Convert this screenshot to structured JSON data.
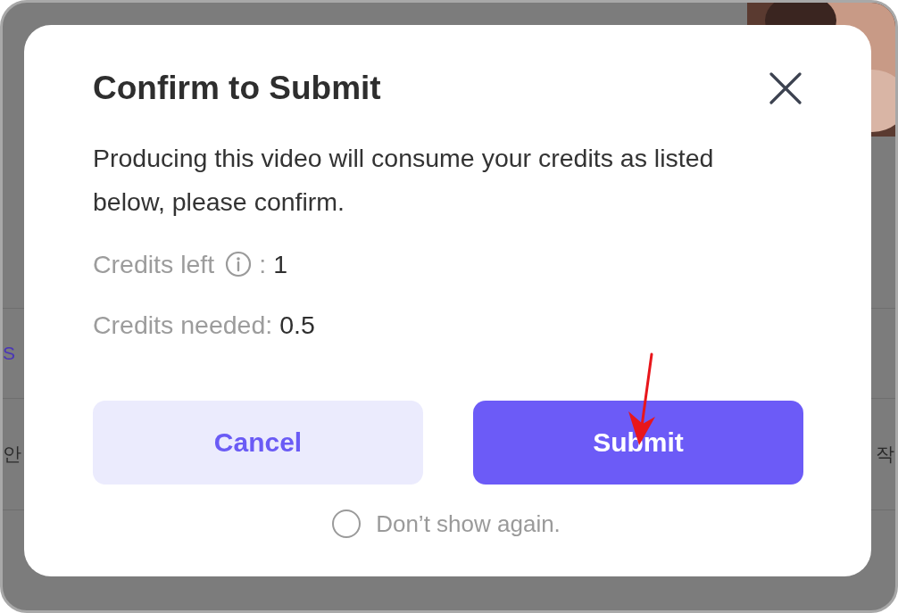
{
  "background": {
    "rows": [
      {
        "left": {
          "kind": "link",
          "text": "S"
        }
      },
      {
        "left": {
          "kind": "plain",
          "text": "안"
        },
        "right": {
          "kind": "plain",
          "text": "작"
        }
      }
    ]
  },
  "dialog": {
    "title": "Confirm to Submit",
    "message": "Producing this video will consume your credits as listed below, please confirm.",
    "credits": [
      {
        "label": "Credits left",
        "info": true,
        "separator": ":",
        "value": "1"
      },
      {
        "label": "Credits needed:",
        "info": false,
        "value": "0.5"
      }
    ],
    "buttons": [
      {
        "kind": "secondary",
        "label": "Cancel"
      },
      {
        "kind": "primary",
        "label": "Submit"
      }
    ],
    "dont_show": {
      "label": "Don’t show again.",
      "checked": false
    }
  }
}
